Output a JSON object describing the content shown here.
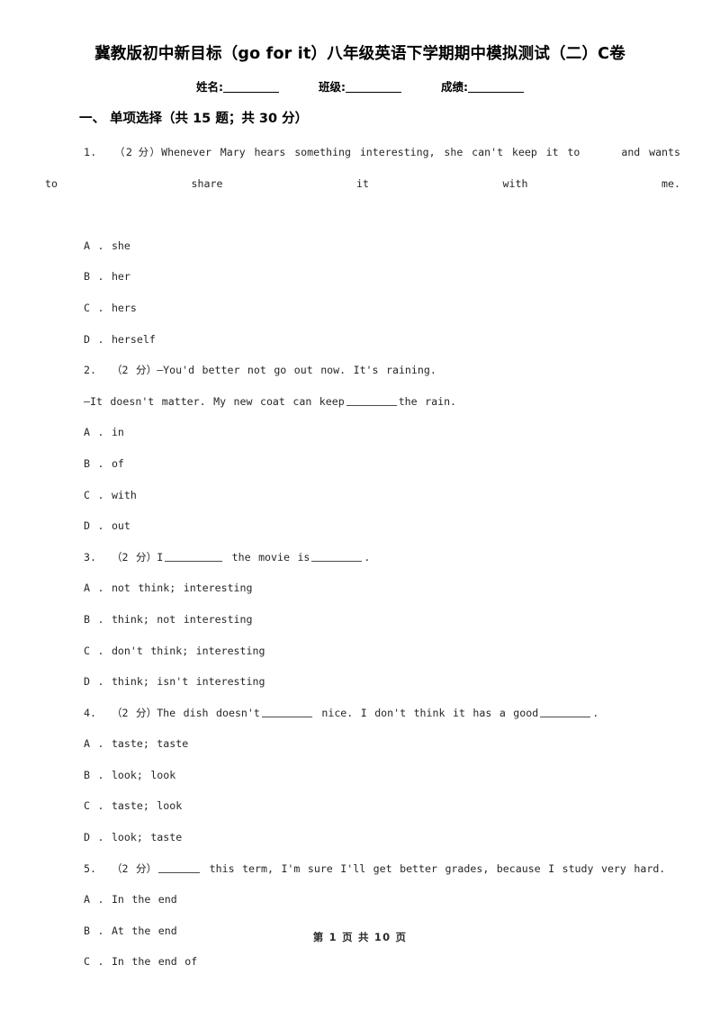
{
  "document": {
    "title": "冀教版初中新目标（go for it）八年级英语下学期期中模拟测试（二）C卷",
    "student_info": [
      {
        "label": "姓名:"
      },
      {
        "label": "班级:"
      },
      {
        "label": "成绩:"
      }
    ],
    "section_heading": "一、 单项选择（共 15 题；共 30 分）",
    "footer": "第 1 页 共 10 页"
  },
  "questions": [
    {
      "number": "1.",
      "marks": "（2 分）",
      "stem_before": "Whenever Mary hears something interesting, she can't keep it to",
      "stem_after": "and wants to share it with me.",
      "options": [
        {
          "key": "A .",
          "text": "she"
        },
        {
          "key": "B .",
          "text": "her"
        },
        {
          "key": "C .",
          "text": "hers"
        },
        {
          "key": "D .",
          "text": "herself"
        }
      ]
    },
    {
      "number": "2.",
      "marks": "（2 分）",
      "stem_before": "—You'd better not go out now. It's raining.",
      "dialogue_before": "—It doesn't matter. My new coat can keep",
      "dialogue_after": "the rain.",
      "options": [
        {
          "key": "A .",
          "text": "in"
        },
        {
          "key": "B .",
          "text": "of"
        },
        {
          "key": "C .",
          "text": "with"
        },
        {
          "key": "D .",
          "text": "out"
        }
      ]
    },
    {
      "number": "3.",
      "marks": "（2 分）",
      "stem_before": "I",
      "stem_mid": "the movie is",
      "stem_after": ".",
      "options": [
        {
          "key": "A .",
          "text": "not think; interesting"
        },
        {
          "key": "B .",
          "text": "think; not interesting"
        },
        {
          "key": "C .",
          "text": "don't think; interesting"
        },
        {
          "key": "D .",
          "text": "think; isn't interesting"
        }
      ]
    },
    {
      "number": "4.",
      "marks": "（2 分）",
      "stem_before": "The dish doesn't",
      "stem_mid": "nice. I don't think it has a good",
      "stem_after": ".",
      "options": [
        {
          "key": "A .",
          "text": "taste; taste"
        },
        {
          "key": "B .",
          "text": "look; look"
        },
        {
          "key": "C .",
          "text": "taste; look"
        },
        {
          "key": "D .",
          "text": "look; taste"
        }
      ]
    },
    {
      "number": "5.",
      "marks": "（2 分）",
      "stem_before": "",
      "stem_after": "this term, I'm sure I'll get better grades, because I study very hard.",
      "options": [
        {
          "key": "A .",
          "text": "In the end"
        },
        {
          "key": "B .",
          "text": "At the end"
        },
        {
          "key": "C .",
          "text": "In the end of"
        }
      ]
    }
  ]
}
